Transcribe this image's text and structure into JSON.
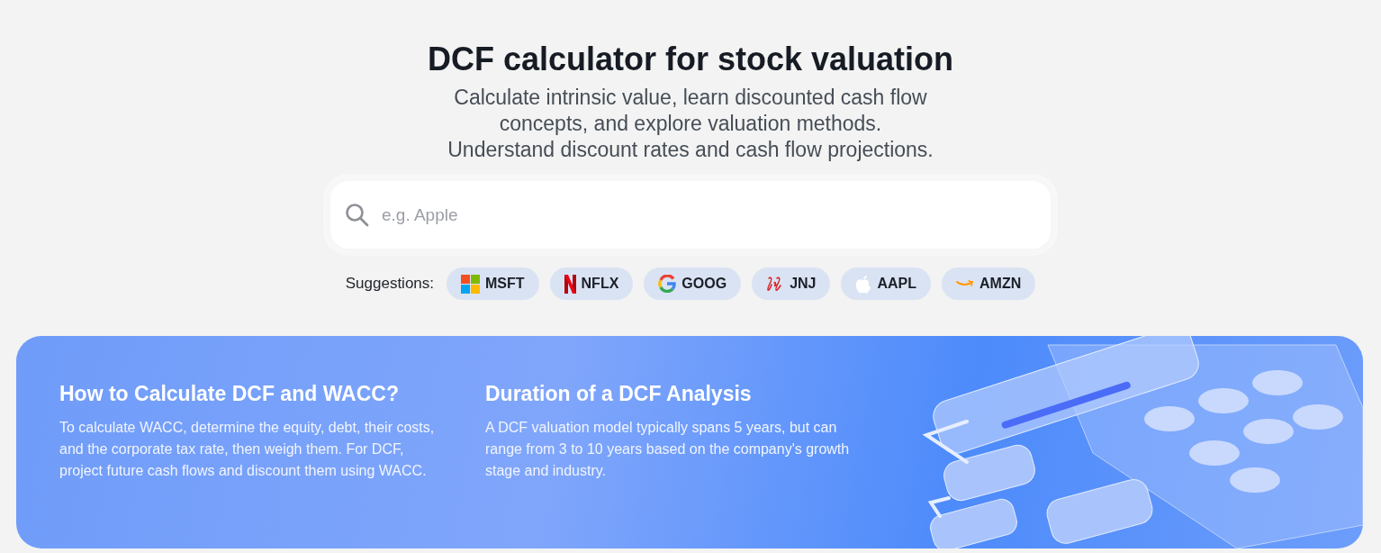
{
  "header": {
    "title": "DCF calculator for stock valuation",
    "subtitle_lines": [
      "Calculate intrinsic value, learn discounted cash flow",
      "concepts, and explore valuation methods.",
      "Understand discount rates and cash flow projections."
    ]
  },
  "search": {
    "placeholder": "e.g. Apple"
  },
  "suggestions": {
    "label": "Suggestions:",
    "items": [
      {
        "ticker": "MSFT",
        "kind": "grid"
      },
      {
        "ticker": "NFLX",
        "kind": "ribbon"
      },
      {
        "ticker": "GOOG",
        "kind": "ring"
      },
      {
        "ticker": "JNJ",
        "kind": "script"
      },
      {
        "ticker": "AAPL",
        "kind": "apple"
      },
      {
        "ticker": "AMZN",
        "kind": "smile"
      }
    ]
  },
  "banner": {
    "sections": [
      {
        "title": "How to Calculate DCF and WACC?",
        "text": "To calculate WACC, determine the equity, debt, their costs, and the corporate tax rate, then weigh them. For DCF, project future cash flows and discount them using WACC."
      },
      {
        "title": "Duration of a DCF Analysis",
        "text": "A DCF valuation model typically spans 5 years, but can range from 3 to 10 years based on the company's growth stage and industry."
      }
    ]
  }
}
